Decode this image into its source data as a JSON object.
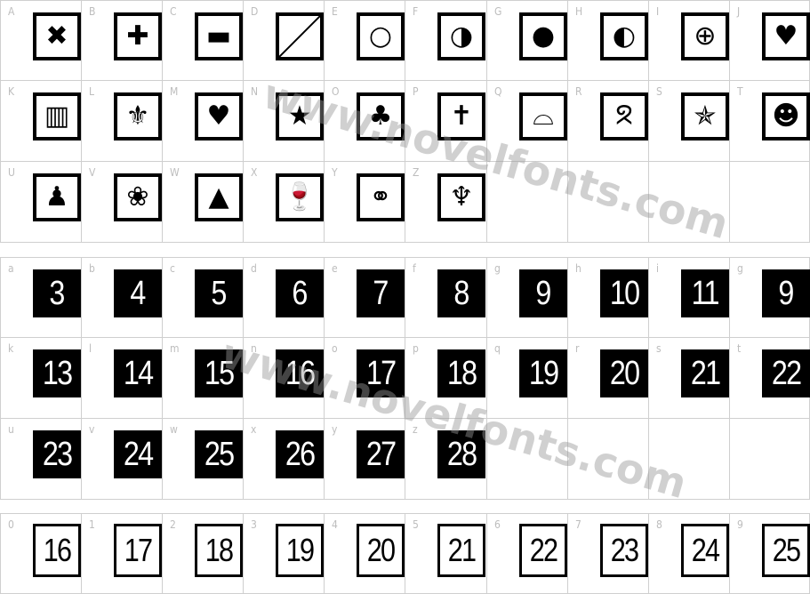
{
  "watermark": "www.novelfonts.com",
  "sections": [
    {
      "style": "icon",
      "cells": [
        {
          "label": "A",
          "icon": "x-mark-icon",
          "glyph": "✖"
        },
        {
          "label": "B",
          "icon": "plus-icon",
          "glyph": "✚"
        },
        {
          "label": "C",
          "icon": "minus-icon",
          "glyph": "▬"
        },
        {
          "label": "D",
          "icon": "diagonal-slash-icon",
          "glyph": ""
        },
        {
          "label": "E",
          "icon": "empty-circle-icon",
          "glyph": "○"
        },
        {
          "label": "F",
          "icon": "half-circle-right-icon",
          "glyph": "◑"
        },
        {
          "label": "G",
          "icon": "filled-circle-icon",
          "glyph": "●"
        },
        {
          "label": "H",
          "icon": "half-circle-left-icon",
          "glyph": "◐"
        },
        {
          "label": "I",
          "icon": "globe-icon",
          "glyph": "⊕"
        },
        {
          "label": "J",
          "icon": "balloons-icon",
          "glyph": "♥"
        },
        {
          "label": "K",
          "icon": "birthday-cake-icon",
          "glyph": "▥"
        },
        {
          "label": "L",
          "icon": "fleur-de-lis-icon",
          "glyph": "⚜"
        },
        {
          "label": "M",
          "icon": "heart-icon",
          "glyph": "♥"
        },
        {
          "label": "N",
          "icon": "star-icon",
          "glyph": "★"
        },
        {
          "label": "O",
          "icon": "shamrock-icon",
          "glyph": "♣"
        },
        {
          "label": "P",
          "icon": "cross-icon",
          "glyph": "✝"
        },
        {
          "label": "Q",
          "icon": "sombrero-icon",
          "glyph": "⌓"
        },
        {
          "label": "R",
          "icon": "awareness-ribbon-icon",
          "glyph": "ᘝ"
        },
        {
          "label": "S",
          "icon": "flag-star-icon",
          "glyph": "✯"
        },
        {
          "label": "T",
          "icon": "jack-o-lantern-icon",
          "glyph": "☻"
        },
        {
          "label": "U",
          "icon": "saluting-soldier-icon",
          "glyph": "♟"
        },
        {
          "label": "V",
          "icon": "turkey-icon",
          "glyph": "❀"
        },
        {
          "label": "W",
          "icon": "christmas-tree-icon",
          "glyph": "▲"
        },
        {
          "label": "X",
          "icon": "wine-glass-icon",
          "glyph": "🍷"
        },
        {
          "label": "Y",
          "icon": "champagne-toast-icon",
          "glyph": "⚭"
        },
        {
          "label": "Z",
          "icon": "menorah-icon",
          "glyph": "♆"
        }
      ]
    },
    {
      "style": "num",
      "cells": [
        {
          "label": "a",
          "text": "3"
        },
        {
          "label": "b",
          "text": "4"
        },
        {
          "label": "c",
          "text": "5"
        },
        {
          "label": "d",
          "text": "6"
        },
        {
          "label": "e",
          "text": "7"
        },
        {
          "label": "f",
          "text": "8"
        },
        {
          "label": "g",
          "text": "9"
        },
        {
          "label": "h",
          "text": "10"
        },
        {
          "label": "i",
          "text": "11"
        },
        {
          "label": "g",
          "text": "9"
        },
        {
          "label": "k",
          "text": "13"
        },
        {
          "label": "l",
          "text": "14"
        },
        {
          "label": "m",
          "text": "15"
        },
        {
          "label": "n",
          "text": "16"
        },
        {
          "label": "o",
          "text": "17"
        },
        {
          "label": "p",
          "text": "18"
        },
        {
          "label": "q",
          "text": "19"
        },
        {
          "label": "r",
          "text": "20"
        },
        {
          "label": "s",
          "text": "21"
        },
        {
          "label": "t",
          "text": "22"
        },
        {
          "label": "u",
          "text": "23"
        },
        {
          "label": "v",
          "text": "24"
        },
        {
          "label": "w",
          "text": "25"
        },
        {
          "label": "x",
          "text": "26"
        },
        {
          "label": "y",
          "text": "27"
        },
        {
          "label": "z",
          "text": "28"
        }
      ]
    },
    {
      "style": "onum",
      "cells": [
        {
          "label": "0",
          "text": "16"
        },
        {
          "label": "1",
          "text": "17"
        },
        {
          "label": "2",
          "text": "18"
        },
        {
          "label": "3",
          "text": "19"
        },
        {
          "label": "4",
          "text": "20"
        },
        {
          "label": "5",
          "text": "21"
        },
        {
          "label": "6",
          "text": "22"
        },
        {
          "label": "7",
          "text": "23"
        },
        {
          "label": "8",
          "text": "24"
        },
        {
          "label": "9",
          "text": "25"
        }
      ]
    }
  ]
}
